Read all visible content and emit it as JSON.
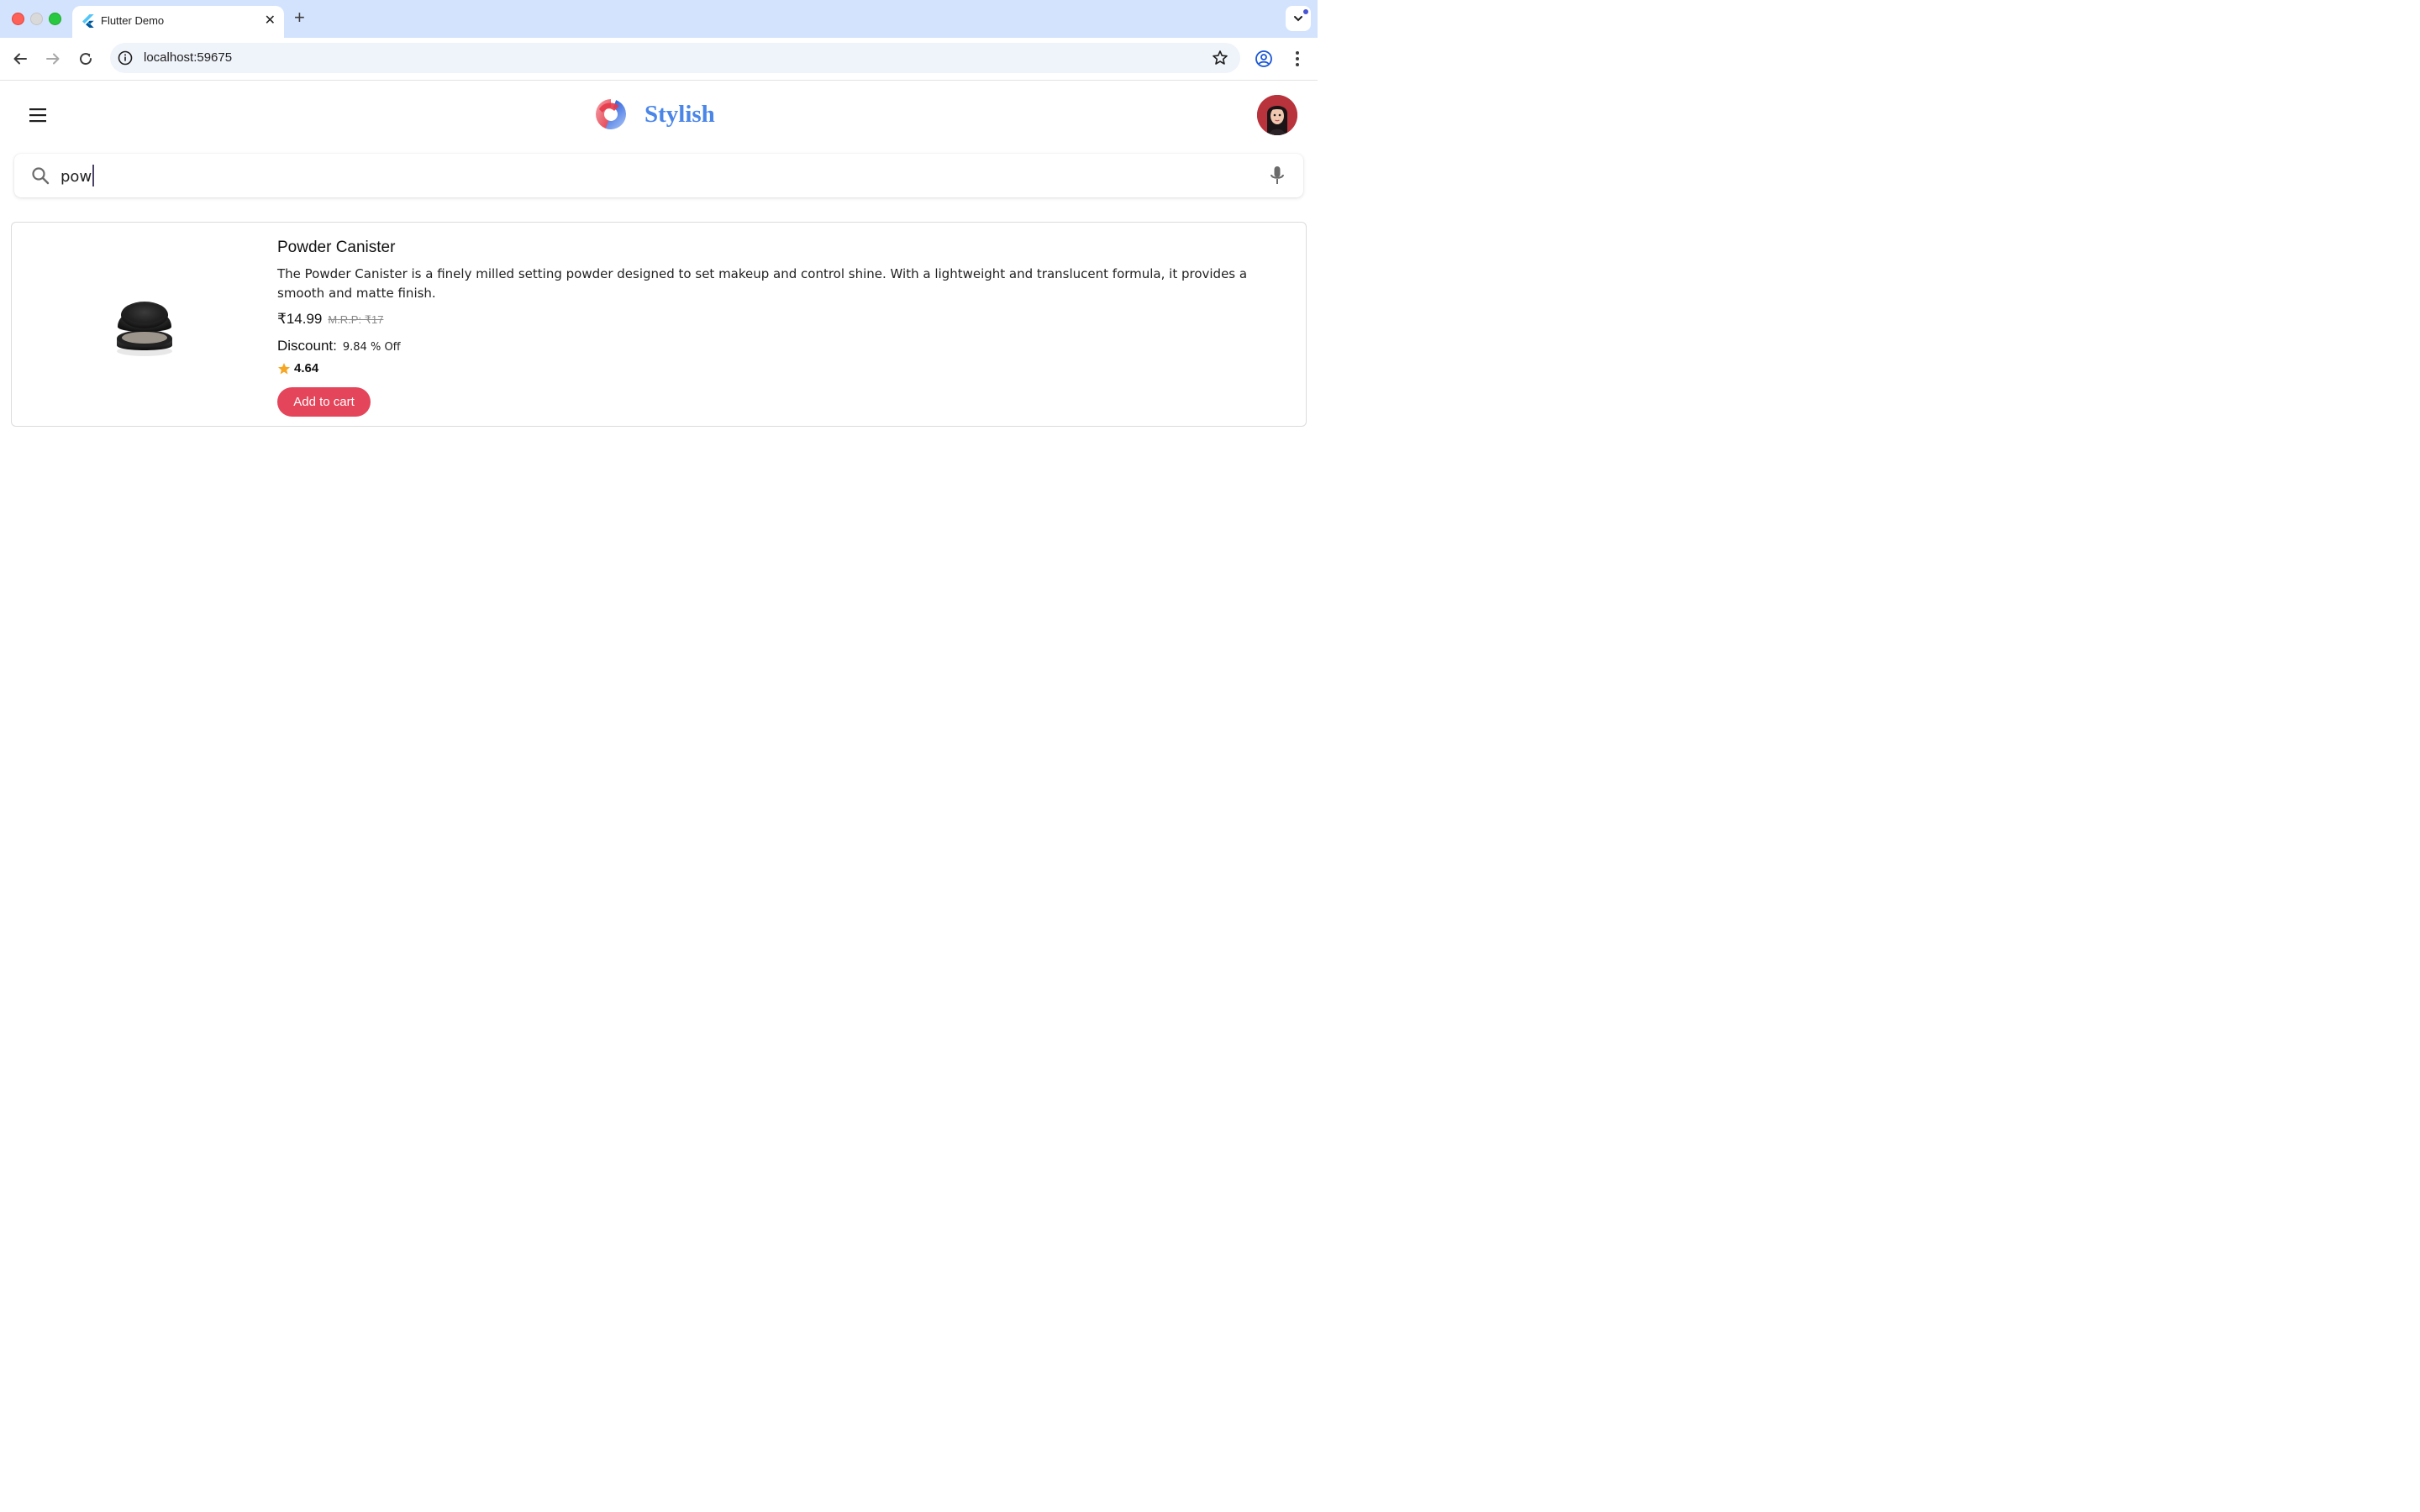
{
  "browser": {
    "tab_title": "Flutter Demo",
    "tab_close": "✕",
    "new_tab": "+",
    "url": "localhost:59675"
  },
  "app": {
    "brand_name": "Stylish",
    "icons": {
      "menu": "hamburger-menu-icon",
      "search": "search-icon",
      "mic": "microphone-icon",
      "star": "star-icon"
    },
    "colors": {
      "brand_blue": "#4a86e8",
      "accent_red": "#e4455a",
      "star_orange": "#f5a623"
    }
  },
  "search": {
    "value": "pow"
  },
  "product": {
    "title": "Powder Canister",
    "description": "The Powder Canister is a finely milled setting powder designed to set makeup and control shine. With a lightweight and translucent formula, it provides a smooth and matte finish.",
    "price": "₹14.99",
    "mrp": "M.R.P: ₹17",
    "discount_label": "Discount:",
    "discount_value": "9.84 % Off",
    "rating": "4.64",
    "cta": "Add to cart"
  }
}
